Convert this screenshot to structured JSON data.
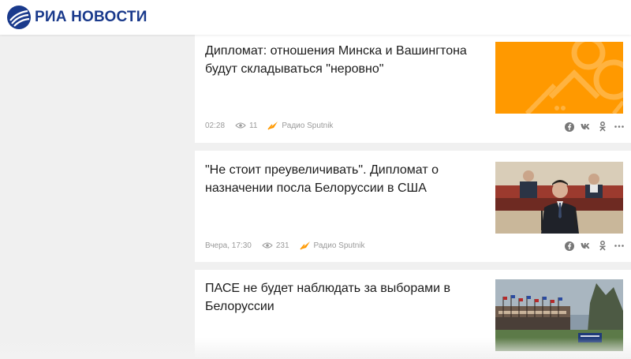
{
  "header": {
    "logo_text": "РИА НОВОСТИ",
    "logo_icon": "ria-logo-icon",
    "brand_color": "#1a3a8c"
  },
  "articles": [
    {
      "title": "Дипломат: отношения Минска и Вашингтона будут складываться \"неровно\"",
      "time": "02:28",
      "views": "11",
      "source": "Радио Sputnik",
      "image": "orange-placeholder-image"
    },
    {
      "title": "\"Не стоит преувеличивать\". Дипломат о назначении посла Белоруссии в США",
      "time": "Вчера, 17:30",
      "views": "231",
      "source": "Радио Sputnik",
      "image": "parliament-speaker-photo"
    },
    {
      "title": "ПАСЕ не будет наблюдать за выборами в Белоруссии",
      "image": "council-of-europe-building-photo"
    }
  ],
  "share_icons": [
    "facebook-icon",
    "vk-icon",
    "odnoklassniki-icon",
    "more-icon"
  ],
  "colors": {
    "accent_orange": "#ff9900",
    "meta_gray": "#9a9a9a"
  }
}
